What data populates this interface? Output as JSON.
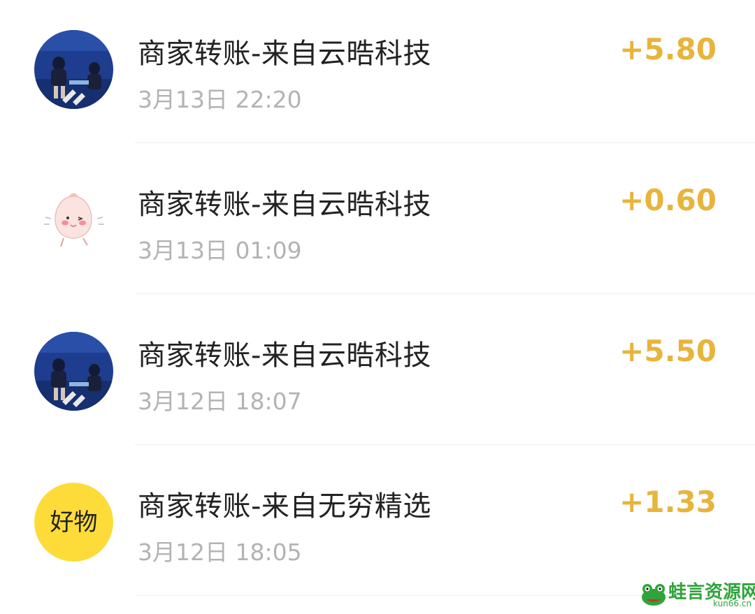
{
  "transactions": [
    {
      "avatar": "concert-photo-avatar",
      "title": "商家转账-来自云晧科技",
      "time": "3月13日 22:20",
      "amount": "+5.80"
    },
    {
      "avatar": "peach-cartoon-avatar",
      "title": "商家转账-来自云晧科技",
      "time": "3月13日 01:09",
      "amount": "+0.60"
    },
    {
      "avatar": "concert-photo-avatar",
      "title": "商家转账-来自云晧科技",
      "time": "3月12日 18:07",
      "amount": "+5.50"
    },
    {
      "avatar": "haowu-logo-avatar",
      "title": "商家转账-来自无穷精选",
      "time": "3月12日 18:05",
      "amount": "+1.33",
      "avatar_text": "好物"
    }
  ],
  "watermark": {
    "text": "蛙言资源网",
    "domain": "kun66.cn"
  },
  "colors": {
    "amount": "#e7b43c",
    "title": "#222222",
    "time": "#b3b3b3",
    "divider": "#eeeeee",
    "haowu_bg": "#fddc3a"
  }
}
